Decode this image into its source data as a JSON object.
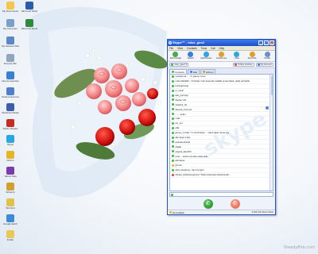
{
  "desktop": {
    "icons": [
      {
        "label": "My Documents",
        "color": "#f1c84b"
      },
      {
        "label": "Microsoft Word",
        "color": "#2a5caa"
      },
      {
        "label": "My Computer",
        "color": "#7aa0c8"
      },
      {
        "label": "Microsoft Excel",
        "color": "#2f8a3c"
      },
      {
        "label": "My Network Places",
        "color": "#5c86c4"
      },
      {
        "label": "Recycle Bin",
        "color": "#8fa6bd"
      },
      {
        "label": "Internet Explorer",
        "color": "#3a7fd0"
      },
      {
        "label": "Outlook Express",
        "color": "#4f7fc9"
      },
      {
        "label": "Windows Media",
        "color": "#3c5ea8"
      },
      {
        "label": "Adobe Reader",
        "color": "#c72c24"
      },
      {
        "label": "Skype",
        "color": "#2aa6e0"
      },
      {
        "label": "Norton",
        "color": "#e6b62a"
      },
      {
        "label": "Yahoo! Mes",
        "color": "#7a3ca8"
      },
      {
        "label": "Winamp",
        "color": "#d0a030"
      },
      {
        "label": "Shortcut",
        "color": "#e2c34a"
      },
      {
        "label": "Google Earth",
        "color": "#3d8bd3"
      },
      {
        "label": "Folder",
        "color": "#e9c85a"
      }
    ],
    "watermark": "Steady8ite.com"
  },
  "skype": {
    "title": "Skype™ - miss_geo2",
    "menu": [
      "File",
      "View",
      "Contacts",
      "Tools",
      "Call",
      "Help"
    ],
    "toolbar": [
      {
        "label": "Add Contact",
        "color": "#4aa84e"
      },
      {
        "label": "Search",
        "color": "#3c7de0"
      },
      {
        "label": "Call Phones",
        "color": "#2aa6e0"
      },
      {
        "label": "Conference",
        "color": "#e2a02a"
      },
      {
        "label": "Chat",
        "color": "#2aa6e0"
      },
      {
        "label": "Send File",
        "color": "#e2a02a"
      },
      {
        "label": "Profile",
        "color": "#6a8fd0"
      }
    ],
    "status": {
      "user": "miss_geo2",
      "online_label": "Online",
      "balance_label": "Online Inactive",
      "account_label": "My Account"
    },
    "tabs": [
      "Contacts",
      "Dial",
      "History"
    ],
    "contacts": [
      {
        "name": "youtube ka ......!!! gak ke zoom",
        "status": "green"
      },
      {
        "name": "code fadhillah, <Youtube> kan kesenian adalah emas bakar, padu perhebat",
        "status": "green"
      },
      {
        "name": "kucingpinang",
        "status": "green"
      },
      {
        "name": "ni_mech",
        "status": "green"
      },
      {
        "name": "kak_ponti lay",
        "status": "green"
      },
      {
        "name": "Sarha->UK",
        "status": "green"
      },
      {
        "name": "shahirul_hd",
        "status": "green"
      },
      {
        "name": "Ahmad_Termedi",
        "status": "green"
      },
      {
        "name": "........putih....",
        "status": "green"
      },
      {
        "name": "maki",
        "status": "green"
      },
      {
        "name": "ien_em",
        "status": "green"
      },
      {
        "name": "effa",
        "status": "green"
      },
      {
        "name": "jamee_muzak / i ni donhunian.... sebut tajuk nama sun",
        "status": "green"
      },
      {
        "name": "aku kaya 1 aku",
        "status": "green"
      },
      {
        "name": "ananda ahmad",
        "status": "green"
      },
      {
        "name": "shalat",
        "status": "green"
      },
      {
        "name": "angela_alee200",
        "status": "green"
      },
      {
        "name": "ema.... sebut menuka muka jada...",
        "status": "green"
      },
      {
        "name": "ashraqua",
        "status": "green"
      },
      {
        "name": "jimmer",
        "status": "yellow"
      },
      {
        "name": "aww_kingkong.. aku di prgun",
        "status": "green"
      },
      {
        "name": "Adnan_hisham(syamsu) <Nafsu bisa atau ibarat kuda>",
        "status": "red"
      }
    ],
    "input_placeholder": "",
    "bottom_left": "Not Available",
    "bottom_right": "5,222,412 Users Online",
    "colors": {
      "green": "#3bb54a",
      "yellow": "#e9b81e",
      "red": "#d9433b",
      "blue": "#3e7bf0"
    }
  }
}
